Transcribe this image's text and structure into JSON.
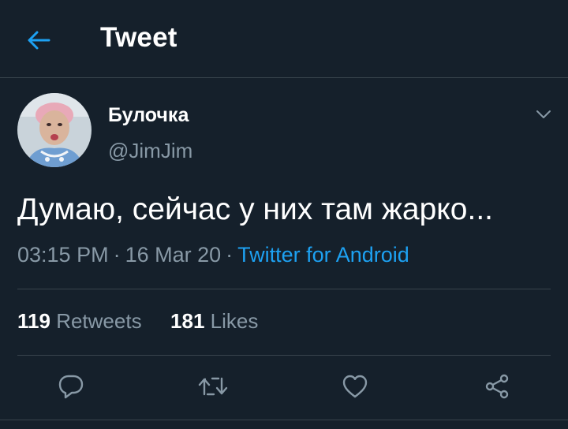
{
  "header": {
    "title": "Tweet",
    "back_icon": "arrow-left-icon"
  },
  "tweet": {
    "author": {
      "display_name": "Булочка",
      "handle": "@JimJim"
    },
    "text": "Думаю, сейчас у них там жарко...",
    "time": "03:15 PM",
    "date": "16 Mar 20",
    "separator": "·",
    "source": "Twitter for Android",
    "stats": {
      "retweets_count": "119",
      "retweets_label": "Retweets",
      "likes_count": "181",
      "likes_label": "Likes"
    }
  },
  "actions": [
    "reply-icon",
    "retweet-icon",
    "like-icon",
    "share-icon"
  ],
  "colors": {
    "background": "#15202b",
    "accent": "#1da1f2",
    "muted": "#8899a6",
    "divider": "#38444d"
  }
}
